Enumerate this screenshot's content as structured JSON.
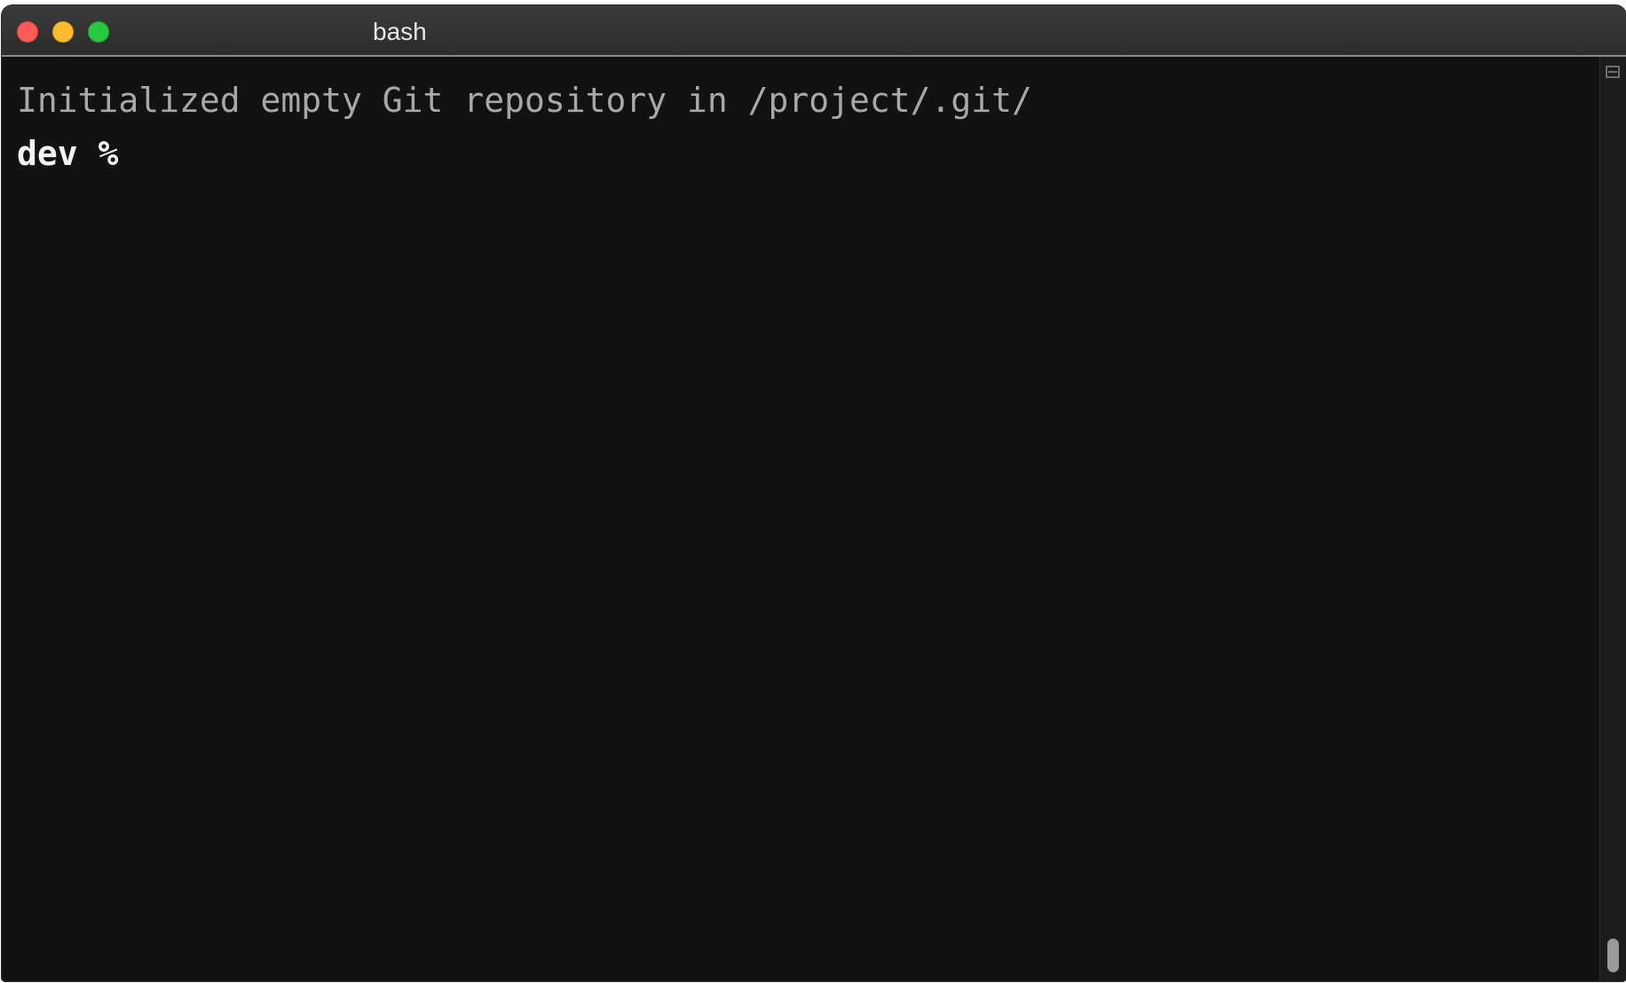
{
  "window": {
    "title": "bash"
  },
  "terminal": {
    "output_line": "Initialized empty Git repository in /project/.git/",
    "prompt": "dev %"
  },
  "icons": {
    "close": "close-button-red-dot",
    "minimize": "minimize-button-yellow-dot",
    "maximize": "maximize-button-green-dot",
    "split": "split-pane-icon"
  },
  "colors": {
    "terminal_background": "#121212",
    "output_text": "#a8a8a8",
    "prompt_text": "#f2f2f2",
    "close": "#fc5c58",
    "minimize": "#fdbb2e",
    "maximize": "#28c840"
  }
}
